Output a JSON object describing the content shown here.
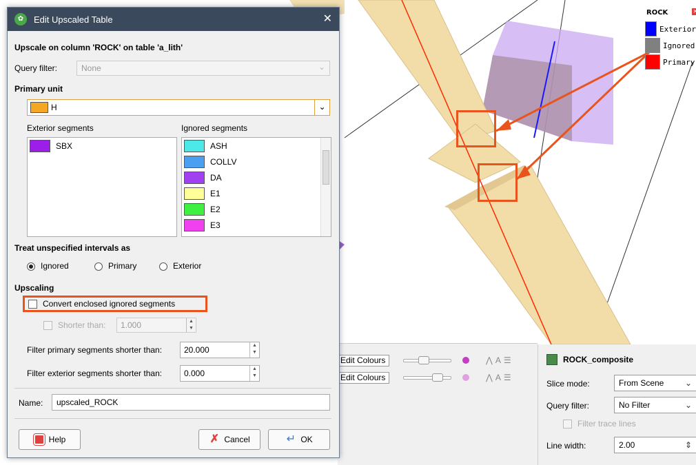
{
  "legend": {
    "title": "ROCK",
    "items": [
      {
        "label": "Exterior",
        "color": "#0000ff"
      },
      {
        "label": "Ignored",
        "color": "#808080"
      },
      {
        "label": "Primary",
        "color": "#ff0000"
      }
    ]
  },
  "colors": {
    "accent": "#e8541c",
    "titlebar": "#3a4a5c",
    "cylinder": "#f2dca8"
  },
  "layers": {
    "rows": [
      {
        "edit_label": "Edit Colours"
      },
      {
        "edit_label": "Edit Colours"
      }
    ]
  },
  "props": {
    "title": "ROCK_composite",
    "slice_mode_label": "Slice mode:",
    "slice_mode_value": "From Scene",
    "query_filter_label": "Query filter:",
    "query_filter_value": "No Filter",
    "filter_trace_lines": "Filter trace lines",
    "line_width_label": "Line width:",
    "line_width_value": "2.00"
  },
  "dialog": {
    "title": "Edit Upscaled Table",
    "heading": "Upscale on column 'ROCK' on table 'a_lith'",
    "query_filter_label": "Query filter:",
    "query_filter_value": "None",
    "primary_unit_label": "Primary unit",
    "primary_unit_value": "H",
    "primary_unit_color": "#f5a623",
    "exterior_label": "Exterior segments",
    "ignored_label": "Ignored segments",
    "exterior_items": [
      {
        "label": "SBX",
        "color": "#9b1fe8"
      }
    ],
    "ignored_items": [
      {
        "label": "ASH",
        "color": "#4de8e8"
      },
      {
        "label": "COLLV",
        "color": "#4a9ff0"
      },
      {
        "label": "DA",
        "color": "#a040f0"
      },
      {
        "label": "E1",
        "color": "#ffff99"
      },
      {
        "label": "E2",
        "color": "#40f040"
      },
      {
        "label": "E3",
        "color": "#f040f0"
      }
    ],
    "treat_label": "Treat unspecified intervals as",
    "radio_ignored": "Ignored",
    "radio_primary": "Primary",
    "radio_exterior": "Exterior",
    "upscaling_label": "Upscaling",
    "convert_label": "Convert enclosed ignored segments",
    "shorter_label": "Shorter than:",
    "shorter_value": "1.000",
    "filter_primary_label": "Filter primary segments shorter than:",
    "filter_primary_value": "20.000",
    "filter_exterior_label": "Filter exterior segments shorter than:",
    "filter_exterior_value": "0.000",
    "name_label": "Name:",
    "name_value": "upscaled_ROCK",
    "help_label": "Help",
    "cancel_label": "Cancel",
    "ok_label": "OK"
  }
}
